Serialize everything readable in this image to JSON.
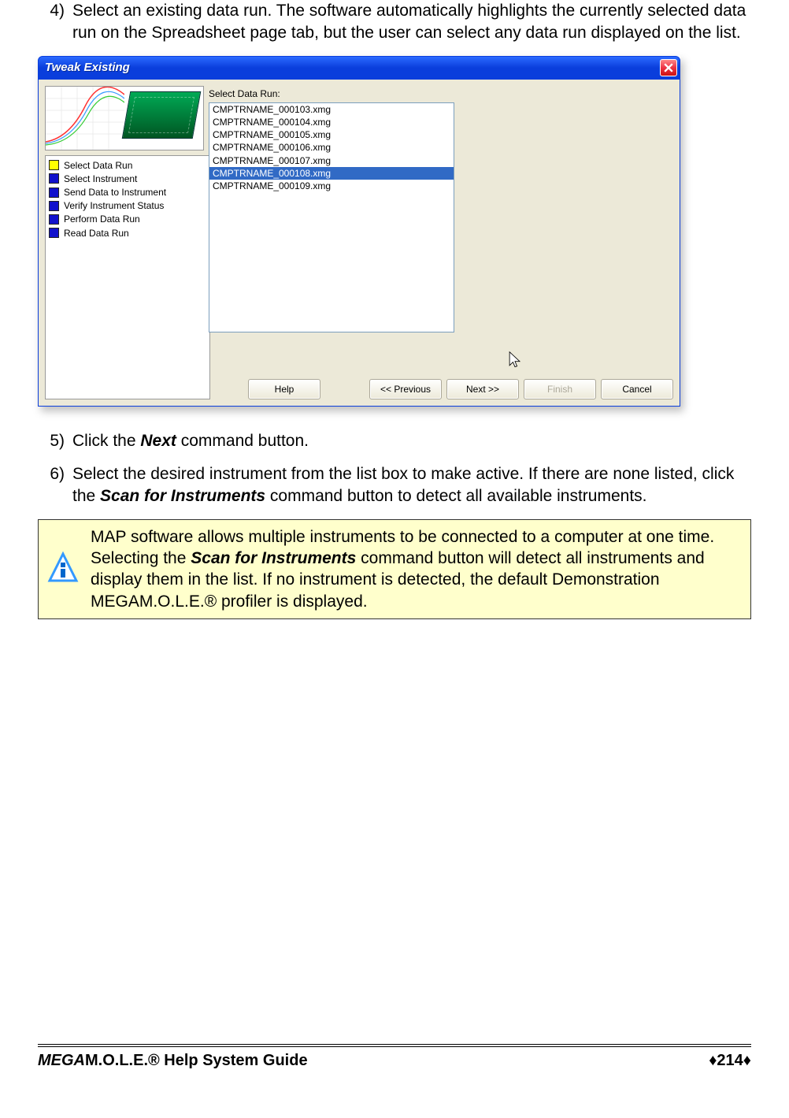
{
  "step4": {
    "num": "4)",
    "text": "Select an existing data run. The software automatically highlights the currently selected data run on the Spreadsheet page tab, but the user can select any data run displayed on the list."
  },
  "step5": {
    "num": "5)",
    "prefix": "Click the ",
    "bold1": "Next",
    "suffix": " command button."
  },
  "step6": {
    "num": "6)",
    "prefix": "Select the desired instrument from the list box to make active. If there are none listed, click the ",
    "bold1": "Scan for Instruments",
    "suffix": " command button to detect all available instruments."
  },
  "dialog": {
    "title": "Tweak Existing",
    "steps": [
      "Select Data Run",
      "Select Instrument",
      "Send Data to Instrument",
      "Verify Instrument Status",
      "Perform Data Run",
      "Read Data Run"
    ],
    "listLabel": "Select Data Run:",
    "items": [
      "CMPTRNAME_000103.xmg",
      "CMPTRNAME_000104.xmg",
      "CMPTRNAME_000105.xmg",
      "CMPTRNAME_000106.xmg",
      "CMPTRNAME_000107.xmg",
      "CMPTRNAME_000108.xmg",
      "CMPTRNAME_000109.xmg"
    ],
    "selectedIndex": 5,
    "buttons": {
      "help": "Help",
      "prev": "<< Previous",
      "next": "Next >>",
      "finish": "Finish",
      "cancel": "Cancel"
    }
  },
  "note": {
    "prefix": "MAP software allows multiple instruments to be connected to a computer at one time. Selecting the ",
    "bold1": "Scan for Instruments",
    "suffix": " command button will detect all instruments and display them in the list. If no instrument is detected, the default Demonstration MEGAM.O.L.E.® profiler is displayed."
  },
  "footer": {
    "leftItalic": "MEGA",
    "leftRest": "M.O.L.E.® Help System Guide",
    "right": "♦214♦"
  }
}
